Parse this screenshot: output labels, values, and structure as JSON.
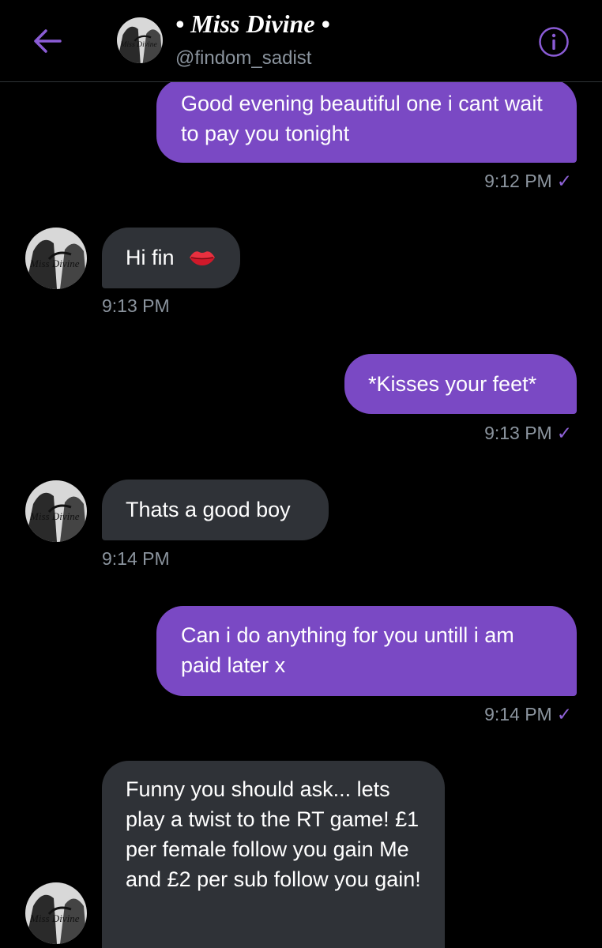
{
  "header": {
    "name": "• Miss Divine •",
    "handle": "@findom_sadist",
    "back_icon": "arrow-left-icon",
    "info_icon": "info-circle-icon",
    "accent": "#8b5cd6"
  },
  "messages": [
    {
      "direction": "out",
      "text": "Good evening beautiful one i cant wait to pay you tonight",
      "time": "9:12 PM",
      "check": "✓"
    },
    {
      "direction": "in",
      "text": "Hi fin",
      "emoji": "kiss-lips-icon",
      "time": "9:13 PM"
    },
    {
      "direction": "out",
      "text": "*Kisses your feet*",
      "time": "9:13 PM",
      "check": "✓"
    },
    {
      "direction": "in",
      "text": "Thats a good boy",
      "time": "9:14 PM"
    },
    {
      "direction": "out",
      "text": "Can i do anything for you untill i am paid later x",
      "time": "9:14 PM",
      "check": "✓"
    },
    {
      "direction": "in",
      "text": "Funny you should ask... lets play a twist to the RT game! £1 per female follow you gain Me and £2 per sub follow you gain!"
    }
  ],
  "colors": {
    "outgoing_bubble": "#7a49c4",
    "incoming_bubble": "#2f3237",
    "timestamp": "#8b949e",
    "background": "#000000"
  }
}
